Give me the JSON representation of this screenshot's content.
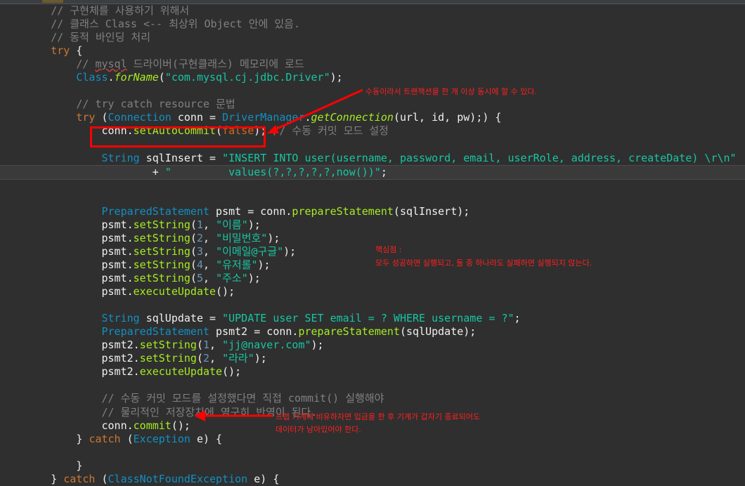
{
  "code_lines": [
    [
      {
        "c": "c",
        "t": "        // 구현체를 사용하기 위해서"
      }
    ],
    [
      {
        "c": "c",
        "t": "        // 클래스 Class <-- 최상위 Object 안에 있음."
      }
    ],
    [
      {
        "c": "c",
        "t": "        // 동적 바인딩 처리"
      }
    ],
    [
      {
        "c": "k",
        "t": "        try"
      },
      {
        "c": "v",
        "t": " {"
      }
    ],
    [
      {
        "c": "c",
        "t": "            // "
      },
      {
        "c": "c sq",
        "t": "mysql"
      },
      {
        "c": "c",
        "t": " 드라이버(구현클래스) 메모리에 로드"
      }
    ],
    [
      {
        "c": "t",
        "t": "            Class"
      },
      {
        "c": "v",
        "t": "."
      },
      {
        "c": "mi",
        "t": "forName"
      },
      {
        "c": "v",
        "t": "("
      },
      {
        "c": "s",
        "t": "\"com.mysql.cj.jdbc.Driver\""
      },
      {
        "c": "v",
        "t": ");"
      }
    ],
    [
      {
        "c": "v",
        "t": ""
      }
    ],
    [
      {
        "c": "c",
        "t": "            // try catch resource 문법"
      }
    ],
    [
      {
        "c": "k",
        "t": "            try"
      },
      {
        "c": "v",
        "t": " ("
      },
      {
        "c": "t",
        "t": "Connection"
      },
      {
        "c": "v",
        "t": " conn = "
      },
      {
        "c": "t",
        "t": "DriverManager"
      },
      {
        "c": "v",
        "t": "."
      },
      {
        "c": "mi",
        "t": "getConnection"
      },
      {
        "c": "v",
        "t": "(url, id, pw);) {"
      }
    ],
    [
      {
        "c": "v",
        "t": "                conn."
      },
      {
        "c": "m",
        "t": "setAutoCommit"
      },
      {
        "c": "v",
        "t": "("
      },
      {
        "c": "kf",
        "t": "false"
      },
      {
        "c": "v",
        "t": "); "
      },
      {
        "c": "c",
        "t": "// 수동 커밋 모드 설정"
      }
    ],
    [
      {
        "c": "v",
        "t": ""
      }
    ],
    [
      {
        "c": "t",
        "t": "                String"
      },
      {
        "c": "v",
        "t": " sqlInsert = "
      },
      {
        "c": "s",
        "t": "\"INSERT INTO user(username, password, email, userRole, address, createDate) \\r\\n\""
      }
    ],
    [
      {
        "c": "v",
        "t": "                        + "
      },
      {
        "c": "s",
        "t": "\"         values(?,?,?,?,?,now())\""
      },
      {
        "c": "v",
        "t": ";"
      }
    ],
    [
      {
        "c": "v",
        "t": ""
      }
    ],
    [
      {
        "c": "v",
        "t": ""
      }
    ],
    [
      {
        "c": "t",
        "t": "                PreparedStatement"
      },
      {
        "c": "v",
        "t": " psmt = conn."
      },
      {
        "c": "m",
        "t": "prepareStatement"
      },
      {
        "c": "v",
        "t": "(sqlInsert);"
      }
    ],
    [
      {
        "c": "v",
        "t": "                psmt."
      },
      {
        "c": "m",
        "t": "setString"
      },
      {
        "c": "v",
        "t": "("
      },
      {
        "c": "n",
        "t": "1"
      },
      {
        "c": "v",
        "t": ", "
      },
      {
        "c": "s",
        "t": "\"이름\""
      },
      {
        "c": "v",
        "t": ");"
      }
    ],
    [
      {
        "c": "v",
        "t": "                psmt."
      },
      {
        "c": "m",
        "t": "setString"
      },
      {
        "c": "v",
        "t": "("
      },
      {
        "c": "n",
        "t": "2"
      },
      {
        "c": "v",
        "t": ", "
      },
      {
        "c": "s",
        "t": "\"비밀번호\""
      },
      {
        "c": "v",
        "t": ");"
      }
    ],
    [
      {
        "c": "v",
        "t": "                psmt."
      },
      {
        "c": "m",
        "t": "setString"
      },
      {
        "c": "v",
        "t": "("
      },
      {
        "c": "n",
        "t": "3"
      },
      {
        "c": "v",
        "t": ", "
      },
      {
        "c": "s",
        "t": "\"이메일@구글\""
      },
      {
        "c": "v",
        "t": ");"
      }
    ],
    [
      {
        "c": "v",
        "t": "                psmt."
      },
      {
        "c": "m",
        "t": "setString"
      },
      {
        "c": "v",
        "t": "("
      },
      {
        "c": "n",
        "t": "4"
      },
      {
        "c": "v",
        "t": ", "
      },
      {
        "c": "s",
        "t": "\"유저롤\""
      },
      {
        "c": "v",
        "t": ");"
      }
    ],
    [
      {
        "c": "v",
        "t": "                psmt."
      },
      {
        "c": "m",
        "t": "setString"
      },
      {
        "c": "v",
        "t": "("
      },
      {
        "c": "n",
        "t": "5"
      },
      {
        "c": "v",
        "t": ", "
      },
      {
        "c": "s",
        "t": "\"주소\""
      },
      {
        "c": "v",
        "t": ");"
      }
    ],
    [
      {
        "c": "v",
        "t": "                psmt."
      },
      {
        "c": "m",
        "t": "executeUpdate"
      },
      {
        "c": "v",
        "t": "();"
      }
    ],
    [
      {
        "c": "v",
        "t": ""
      }
    ],
    [
      {
        "c": "t",
        "t": "                String"
      },
      {
        "c": "v",
        "t": " sqlUpdate = "
      },
      {
        "c": "s",
        "t": "\"UPDATE user SET email = ? WHERE username = ?\""
      },
      {
        "c": "v",
        "t": ";"
      }
    ],
    [
      {
        "c": "t",
        "t": "                PreparedStatement"
      },
      {
        "c": "v",
        "t": " psmt2 = conn."
      },
      {
        "c": "m",
        "t": "prepareStatement"
      },
      {
        "c": "v",
        "t": "(sqlUpdate);"
      }
    ],
    [
      {
        "c": "v",
        "t": "                psmt2."
      },
      {
        "c": "m",
        "t": "setString"
      },
      {
        "c": "v",
        "t": "("
      },
      {
        "c": "n",
        "t": "1"
      },
      {
        "c": "v",
        "t": ", "
      },
      {
        "c": "s",
        "t": "\"jj@naver.com\""
      },
      {
        "c": "v",
        "t": ");"
      }
    ],
    [
      {
        "c": "v",
        "t": "                psmt2."
      },
      {
        "c": "m",
        "t": "setString"
      },
      {
        "c": "v",
        "t": "("
      },
      {
        "c": "n",
        "t": "2"
      },
      {
        "c": "v",
        "t": ", "
      },
      {
        "c": "s",
        "t": "\"라라\""
      },
      {
        "c": "v",
        "t": ");"
      }
    ],
    [
      {
        "c": "v",
        "t": "                psmt2."
      },
      {
        "c": "m",
        "t": "executeUpdate"
      },
      {
        "c": "v",
        "t": "();"
      }
    ],
    [
      {
        "c": "v",
        "t": ""
      }
    ],
    [
      {
        "c": "c",
        "t": "                // 수동 커밋 모드를 설정했다면 직접 commit() 실행해야"
      }
    ],
    [
      {
        "c": "c",
        "t": "                // 물리적인 저장장치에 영구히 반영이 된다."
      }
    ],
    [
      {
        "c": "v",
        "t": "                conn."
      },
      {
        "c": "m",
        "t": "commit"
      },
      {
        "c": "v",
        "t": "();"
      }
    ],
    [
      {
        "c": "v",
        "t": "            } "
      },
      {
        "c": "k",
        "t": "catch"
      },
      {
        "c": "v",
        "t": " ("
      },
      {
        "c": "t",
        "t": "Exception"
      },
      {
        "c": "v",
        "t": " e) {"
      }
    ],
    [
      {
        "c": "v",
        "t": ""
      }
    ],
    [
      {
        "c": "v",
        "t": "            }"
      }
    ],
    [
      {
        "c": "v",
        "t": "        } "
      },
      {
        "c": "k",
        "t": "catch"
      },
      {
        "c": "v",
        "t": " ("
      },
      {
        "c": "t",
        "t": "ClassNotFoundException"
      },
      {
        "c": "v",
        "t": " e) {"
      }
    ]
  ],
  "annotations": {
    "note1": "수동이라서 트랜잭션을 한 개 이상 동시에 할 수 있다.",
    "note2_title": "핵심점 :",
    "note2_body": "모두 성공하면 실행되고, 둘 중 하나라도 실패하면 실행되지 않는다.",
    "note3_line1": "프렙 기계에 비유하자면 입금을 한 후 기계가 갑자기 종료되어도",
    "note3_line2": "데이터가 남아있어야 한다."
  },
  "colors": {
    "background": "#2f2f2f",
    "comment": "#808080",
    "keyword": "#cc7832",
    "type": "#1290c3",
    "method": "#a7ec21",
    "string": "#17c6a3",
    "annotation_red": "#ff0000"
  }
}
